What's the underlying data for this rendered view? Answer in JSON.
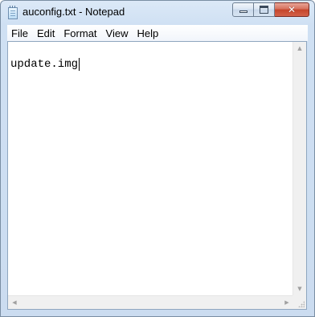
{
  "window": {
    "title": "auconfig.txt - Notepad",
    "app_icon": "notepad-icon"
  },
  "caption_buttons": {
    "minimize": "minimize-icon",
    "maximize": "maximize-icon",
    "close_glyph": "✕"
  },
  "menu": {
    "items": [
      "File",
      "Edit",
      "Format",
      "View",
      "Help"
    ]
  },
  "editor": {
    "content": "update.img"
  },
  "scrollbars": {
    "up_arrow": "▲",
    "down_arrow": "▼",
    "left_arrow": "◀",
    "right_arrow": "▶"
  },
  "colors": {
    "frame": "#cbdcf0",
    "close_button": "#c5442b",
    "editor_background": "#ffffff"
  }
}
